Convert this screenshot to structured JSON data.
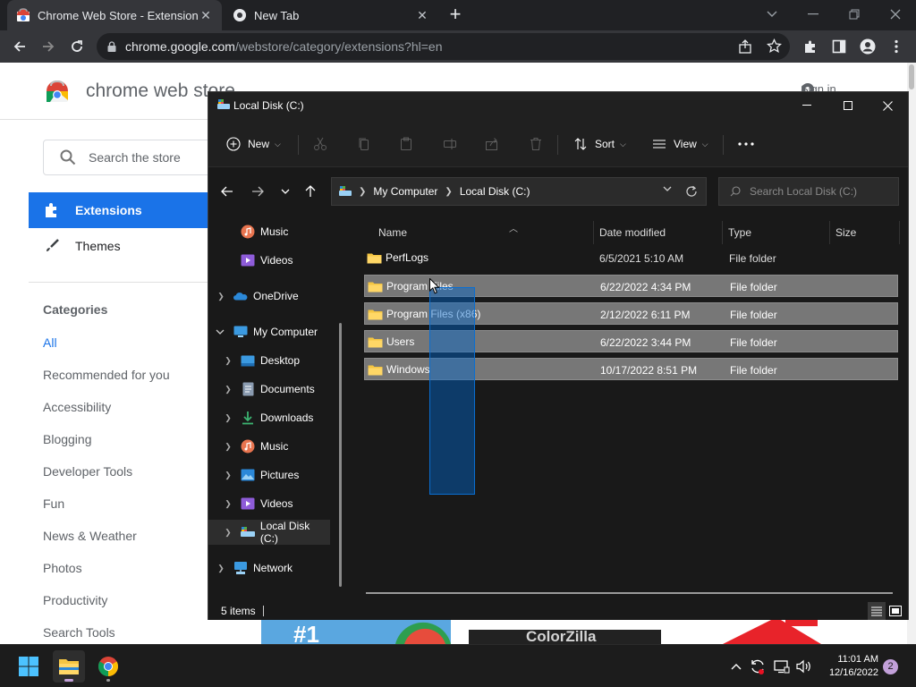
{
  "browser": {
    "tabs": [
      {
        "title": "Chrome Web Store - Extensions",
        "icon": "chrome-web-store-icon",
        "active": true
      },
      {
        "title": "New Tab",
        "icon": "chrome-icon",
        "active": false
      }
    ],
    "url_host": "chrome.google.com",
    "url_path": "/webstore/category/extensions?hl=en"
  },
  "webstore": {
    "title": "chrome web store",
    "signin": "Sign in",
    "search_placeholder": "Search the store",
    "nav": [
      {
        "label": "Extensions",
        "icon": "puzzle-icon",
        "active": true
      },
      {
        "label": "Themes",
        "icon": "brush-icon",
        "active": false
      }
    ],
    "categories_title": "Categories",
    "categories": [
      "All",
      "Recommended for you",
      "Accessibility",
      "Blogging",
      "Developer Tools",
      "Fun",
      "News & Weather",
      "Photos",
      "Productivity",
      "Search Tools"
    ],
    "banner_text": "ColorZilla"
  },
  "explorer": {
    "title": "Local Disk (C:)",
    "commands": {
      "new": "New",
      "sort": "Sort",
      "view": "View"
    },
    "breadcrumb": [
      "My Computer",
      "Local Disk (C:)"
    ],
    "search_placeholder": "Search Local Disk (C:)",
    "nav_pane": [
      {
        "label": "Music",
        "icon": "music-icon",
        "indent": 1,
        "expander": false,
        "selected": false
      },
      {
        "label": "Videos",
        "icon": "videos-icon",
        "indent": 1,
        "expander": false,
        "selected": false
      },
      {
        "label": "OneDrive",
        "icon": "onedrive-icon",
        "indent": 0,
        "expander": "collapsed",
        "selected": false
      },
      {
        "label": "My Computer",
        "icon": "computer-icon",
        "indent": 0,
        "expander": "expanded",
        "selected": false
      },
      {
        "label": "Desktop",
        "icon": "desktop-icon",
        "indent": 1,
        "expander": "collapsed",
        "selected": false
      },
      {
        "label": "Documents",
        "icon": "documents-icon",
        "indent": 1,
        "expander": "collapsed",
        "selected": false
      },
      {
        "label": "Downloads",
        "icon": "downloads-icon",
        "indent": 1,
        "expander": "collapsed",
        "selected": false
      },
      {
        "label": "Music",
        "icon": "music-icon",
        "indent": 1,
        "expander": "collapsed",
        "selected": false
      },
      {
        "label": "Pictures",
        "icon": "pictures-icon",
        "indent": 1,
        "expander": "collapsed",
        "selected": false
      },
      {
        "label": "Videos",
        "icon": "videos-icon",
        "indent": 1,
        "expander": "collapsed",
        "selected": false
      },
      {
        "label": "Local Disk (C:)",
        "icon": "drive-icon",
        "indent": 1,
        "expander": "collapsed",
        "selected": true
      },
      {
        "label": "Network",
        "icon": "network-icon",
        "indent": 0,
        "expander": "collapsed",
        "selected": false
      }
    ],
    "columns": {
      "name": "Name",
      "date": "Date modified",
      "type": "Type",
      "size": "Size"
    },
    "files": [
      {
        "name": "PerfLogs",
        "date": "6/5/2021 5:10 AM",
        "type": "File folder",
        "selected": false
      },
      {
        "name": "Program Files",
        "date": "6/22/2022 4:34 PM",
        "type": "File folder",
        "selected": true
      },
      {
        "name": "Program Files (x86)",
        "date": "2/12/2022 6:11 PM",
        "type": "File folder",
        "selected": true
      },
      {
        "name": "Users",
        "date": "6/22/2022 3:44 PM",
        "type": "File folder",
        "selected": true
      },
      {
        "name": "Windows",
        "date": "10/17/2022 8:51 PM",
        "type": "File folder",
        "selected": true
      }
    ],
    "status": "5 items"
  },
  "taskbar": {
    "time": "11:01 AM",
    "date": "12/16/2022",
    "notifications": "2"
  },
  "colors": {
    "accent": "#1a73e8",
    "folder": "#f4c542",
    "selection": "#777777",
    "marquee": "#0a6ed1"
  }
}
